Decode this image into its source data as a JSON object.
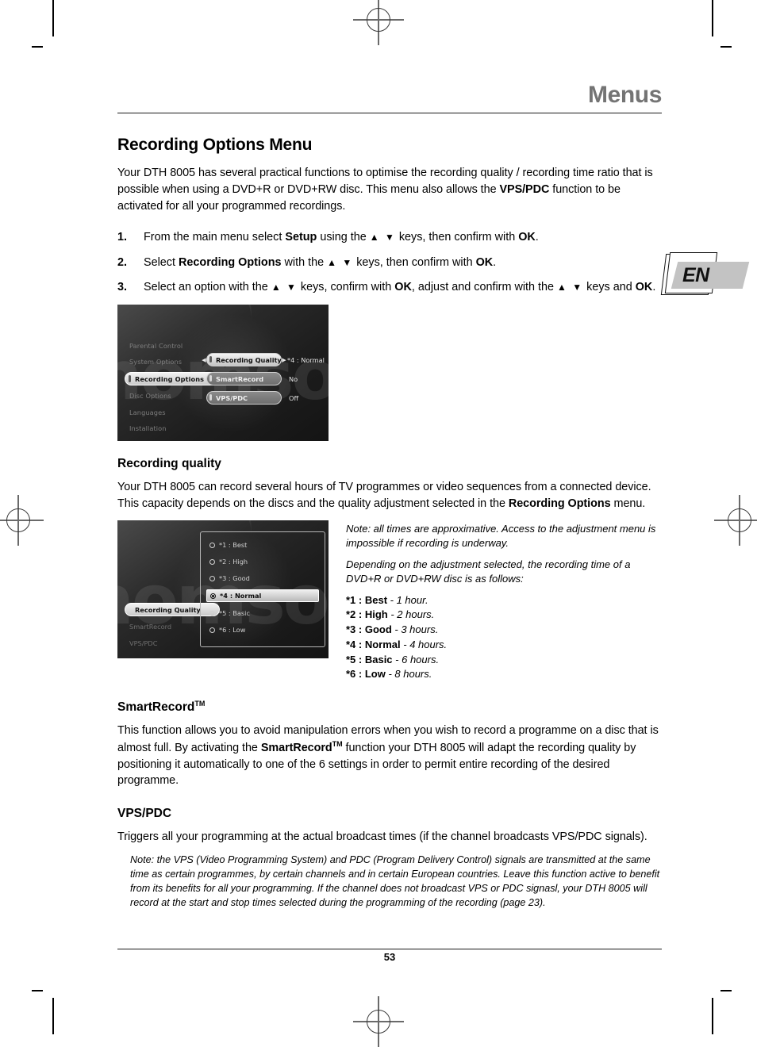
{
  "page": {
    "running_head": "Menus",
    "folio": "53"
  },
  "section": {
    "title": "Recording Options Menu",
    "intro_1": "Your DTH 8005 has several practical functions to optimise the recording quality / recording time ratio that is possible when using a DVD+R or DVD+RW disc. This menu also allows the ",
    "intro_vpspdc": "VPS/PDC",
    "intro_2": " function to be activated for all your programmed recordings."
  },
  "steps": [
    {
      "num": "1.",
      "a": "From the main menu select ",
      "b1": "Setup",
      "c": " using the ",
      "arrows": "▲ ▼",
      "d": " keys, then confirm with ",
      "b2": "OK",
      "e": "."
    },
    {
      "num": "2.",
      "a": "Select ",
      "b1": "Recording Options",
      "c": " with the ",
      "arrows": "▲ ▼",
      "d": " keys, then confirm with ",
      "b2": "OK",
      "e": "."
    },
    {
      "num": "3.",
      "a": "Select an option with the ",
      "arrows": "▲ ▼",
      "c": " keys, confirm with ",
      "b1": "OK",
      "d": ", adjust and confirm with the ",
      "arrows2": "▲ ▼",
      "e": " keys and ",
      "b2": "OK",
      "f": "."
    }
  ],
  "screenshot_1": {
    "watermark": "thomson",
    "sidebar": [
      {
        "label": "Parental Control",
        "selected": false
      },
      {
        "label": "System Options",
        "selected": false
      },
      {
        "label": "Recording Options",
        "selected": true
      },
      {
        "label": "Disc Options",
        "selected": false
      },
      {
        "label": "Languages",
        "selected": false
      },
      {
        "label": "Installation",
        "selected": false
      }
    ],
    "options": [
      {
        "label": "Recording Quality",
        "value": "*4 : Normal",
        "highlighted": true,
        "left_caret": "◀",
        "right_caret": "▶"
      },
      {
        "label": "SmartRecord",
        "value": "No",
        "highlighted": false,
        "left_caret": "",
        "right_caret": ""
      },
      {
        "label": "VPS/PDC",
        "value": "Off",
        "highlighted": false,
        "left_caret": "",
        "right_caret": ""
      }
    ]
  },
  "screenshot_2": {
    "watermark": "thomson",
    "sidebar": [
      {
        "label": "Recording Quality",
        "selected": true
      },
      {
        "label": "SmartRecord",
        "selected": false
      },
      {
        "label": "VPS/PDC",
        "selected": false
      }
    ],
    "radio_options": [
      {
        "label": "*1 : Best",
        "selected": false
      },
      {
        "label": "*2 : High",
        "selected": false
      },
      {
        "label": "*3 : Good",
        "selected": false
      },
      {
        "label": "*4 : Normal",
        "selected": true
      },
      {
        "label": "*5 : Basic",
        "selected": false
      },
      {
        "label": "*6 : Low",
        "selected": false
      }
    ]
  },
  "recording_quality": {
    "heading": "Recording quality",
    "body_1": "Your DTH 8005 can record several hours of TV programmes or video sequences from a connected device. This capacity depends on the discs and the quality adjustment selected in the ",
    "body_bold": "Recording Options",
    "body_2": " menu.",
    "note_1": "Note: all times are approximative. Access to the adjustment menu is impossible if recording is underway.",
    "note_2": "Depending on the adjustment selected, the recording time of a DVD+R or DVD+RW disc is as follows:",
    "times": [
      {
        "setting": "*1 : Best",
        "duration": " - 1 hour."
      },
      {
        "setting": "*2 : High",
        "duration": " - 2 hours."
      },
      {
        "setting": "*3 : Good",
        "duration": " - 3 hours."
      },
      {
        "setting": "*4 : Normal",
        "duration": " - 4 hours."
      },
      {
        "setting": "*5 : Basic",
        "duration": " - 6 hours."
      },
      {
        "setting": "*6 : Low",
        "duration": " - 8 hours."
      }
    ]
  },
  "smartrecord": {
    "heading": "SmartRecord",
    "heading_tm": "TM",
    "body_1": "This function allows you to avoid manipulation errors when you wish to record a programme on a disc that is almost full. By activating the ",
    "body_bold": "SmartRecord",
    "body_bold_tm": "TM",
    "body_2": " function your DTH 8005 will adapt the recording quality by positioning it automatically to one of the 6 settings in order to permit entire recording of the desired programme."
  },
  "vpspdc": {
    "heading": "VPS/PDC",
    "body": "Triggers all your programming at the actual broadcast times (if the channel broadcasts VPS/PDC signals).",
    "note": "Note:  the VPS (Video Programming System) and PDC (Program Delivery Control) signals are transmitted at the same time as certain programmes, by certain channels and in certain European countries. Leave this function active to benefit from its benefits for all your programming. If the channel does not broadcast VPS or PDC signasl, your DTH 8005 will record at the start and stop times selected during the programming of the recording (page 23)."
  },
  "badge": {
    "language_code": "EN"
  }
}
